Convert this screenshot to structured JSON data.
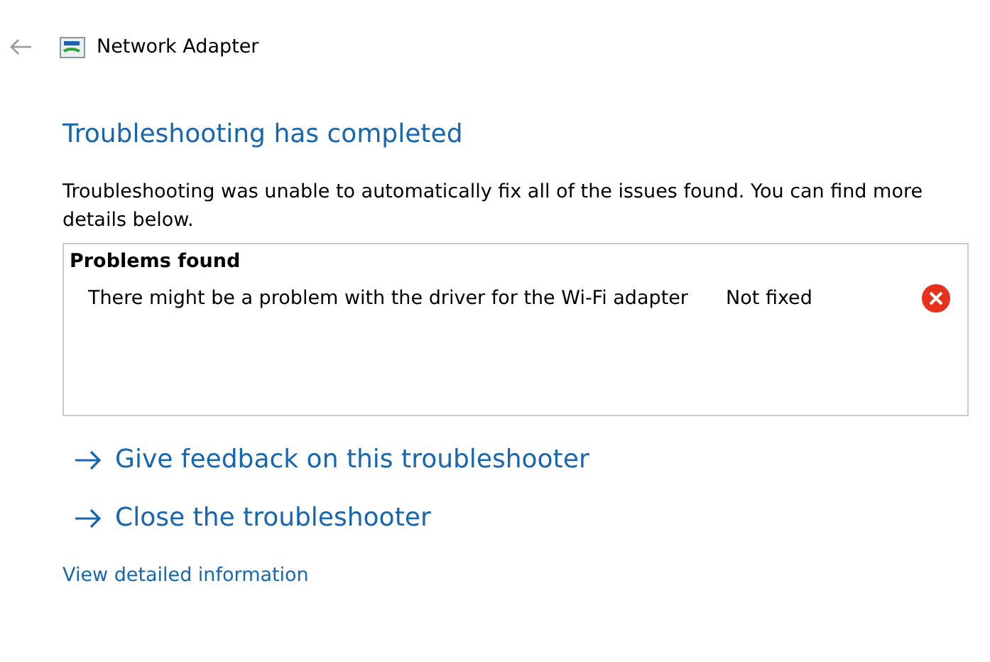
{
  "window": {
    "title": "Network Adapter"
  },
  "heading": "Troubleshooting has completed",
  "message": "Troubleshooting was unable to automatically fix all of the issues found. You can find more details below.",
  "problems": {
    "title": "Problems found",
    "rows": [
      {
        "description": "There might be a problem with the driver for the Wi-Fi adapter",
        "status": "Not fixed",
        "kind": "not_fixed"
      }
    ]
  },
  "actions": [
    "Give feedback on this troubleshooter",
    "Close the troubleshooter"
  ],
  "details_link": "View detailed information"
}
